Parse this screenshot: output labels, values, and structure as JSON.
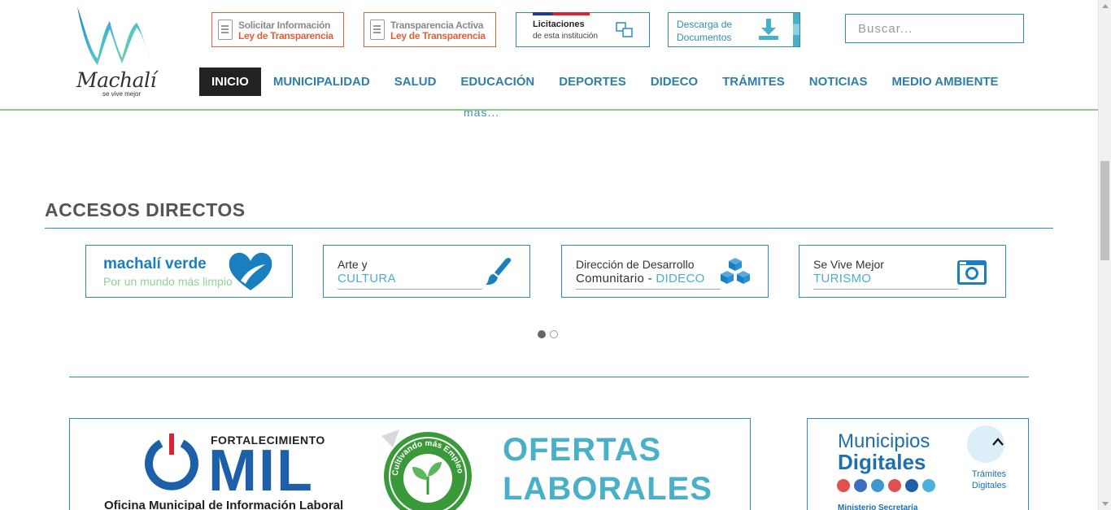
{
  "header": {
    "logo": {
      "word": "Machalí",
      "tagline": "se vive mejor"
    },
    "solicitar": {
      "line1": "Solicitar Información",
      "line2": "Ley de Transparencia"
    },
    "transparencia": {
      "line1": "Transparencia Activa",
      "line2": "Ley de Transparencia"
    },
    "licitaciones": {
      "line1": "Licitaciones",
      "line2": "de esta institución"
    },
    "descarga": {
      "line1": "Descarga de",
      "line2": "Documentos"
    },
    "search": {
      "placeholder": "Buscar..."
    },
    "nav": [
      {
        "label": "INICIO",
        "active": true
      },
      {
        "label": "MUNICIPALIDAD"
      },
      {
        "label": "SALUD"
      },
      {
        "label": "EDUCACIÓN"
      },
      {
        "label": "DEPORTES"
      },
      {
        "label": "DIDECO"
      },
      {
        "label": "TRÁMITES"
      },
      {
        "label": "NOTICIAS"
      },
      {
        "label": "MEDIO AMBIENTE"
      }
    ]
  },
  "content": {
    "more_link": "más...",
    "accesos_title": "ACCESOS DIRECTOS",
    "cards": [
      {
        "title": "machalí verde",
        "subtitle": "Por un mundo más limpio",
        "icon": "heart-icon"
      },
      {
        "line1": "Arte  y",
        "line2": "CULTURA",
        "icon": "paintbrush-icon"
      },
      {
        "line1": "Dirección de Desarrollo",
        "line2_dark": "Comunitario - ",
        "line2": "DIDECO",
        "icon": "boxes-icon"
      },
      {
        "line1": "Se Vive Mejor",
        "line2": "TURISMO",
        "icon": "camera-icon"
      }
    ],
    "carousel": {
      "active_index": 0,
      "pages": 2
    },
    "banner": {
      "fortalecimiento": "FORTALECIMIENTO",
      "mil": "MIL",
      "oficina": "Oficina Municipal de Información Laboral",
      "seal_text": "Cultivando más Empleo",
      "ofertas": "OFERTAS",
      "laborales": "LABORALES"
    },
    "side": {
      "line1": "Municipios",
      "line2": "Digitales",
      "tramites1": "Trámites",
      "tramites2": "Digitales",
      "ministerio": "Ministerio Secretaría"
    }
  },
  "colors": {
    "accent_blue": "#2f8bb5",
    "orange": "#e0603a",
    "nav_text": "#2f7fa8",
    "green_rule": "#8fc98a",
    "light_teal": "#4ab0c8"
  }
}
